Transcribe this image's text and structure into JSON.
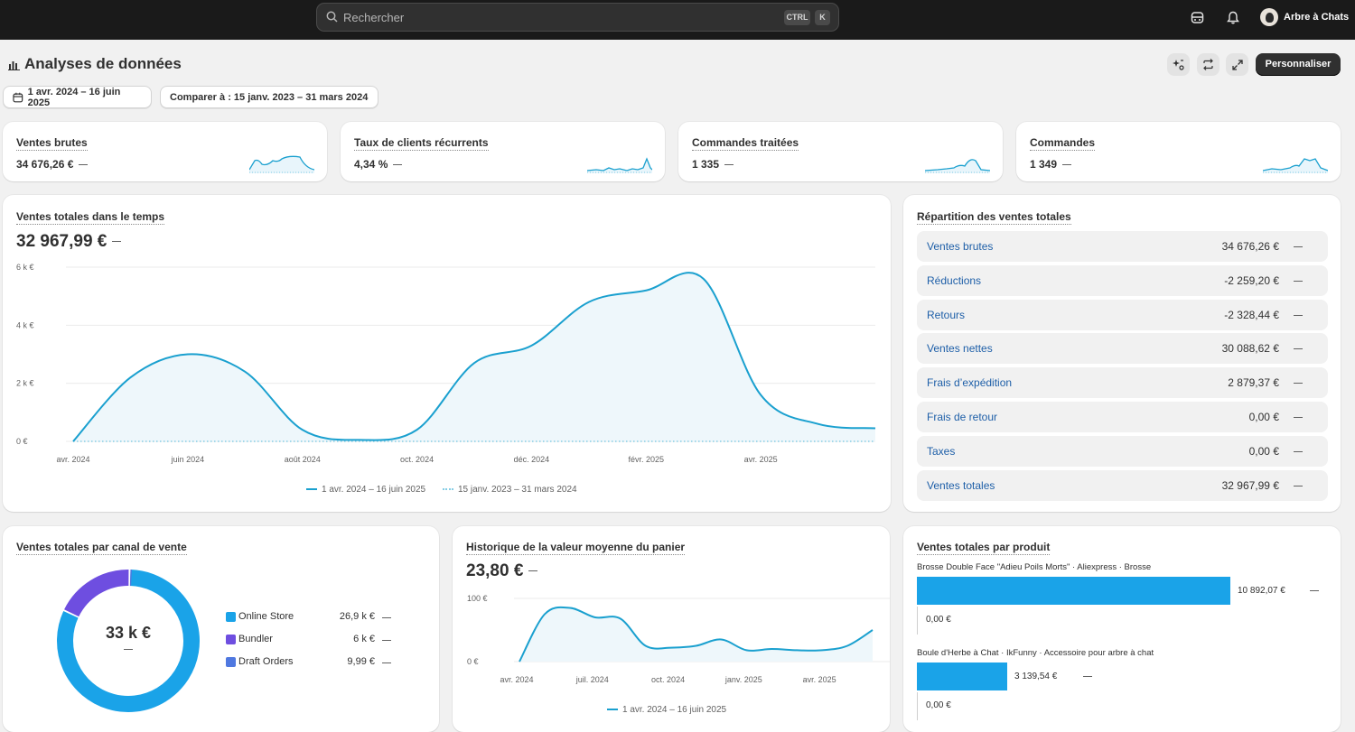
{
  "topbar": {
    "search_placeholder": "Rechercher",
    "kbd_ctrl": "CTRL",
    "kbd_k": "K",
    "store_name": "Arbre à Chats"
  },
  "header": {
    "title": "Analyses de données",
    "customize_label": "Personnaliser",
    "date_range": "1 avr. 2024 – 16 juin 2025",
    "compare_range": "Comparer à : 15 janv. 2023 – 31 mars 2024"
  },
  "kpis": [
    {
      "label": "Ventes brutes",
      "value": "34 676,26 €"
    },
    {
      "label": "Taux de clients récurrents",
      "value": "4,34 %"
    },
    {
      "label": "Commandes traitées",
      "value": "1 335"
    },
    {
      "label": "Commandes",
      "value": "1 349"
    }
  ],
  "sales_over_time": {
    "title": "Ventes totales dans le temps",
    "total": "32 967,99 €",
    "legend_current": "1 avr. 2024 – 16 juin 2025",
    "legend_compare": "15 janv. 2023 – 31 mars 2024"
  },
  "breakdown": {
    "title": "Répartition des ventes totales",
    "rows": [
      {
        "label": "Ventes brutes",
        "value": "34 676,26 €"
      },
      {
        "label": "Réductions",
        "value": "-2 259,20 €"
      },
      {
        "label": "Retours",
        "value": "-2 328,44 €"
      },
      {
        "label": "Ventes nettes",
        "value": "30 088,62 €"
      },
      {
        "label": "Frais d’expédition",
        "value": "2 879,37 €"
      },
      {
        "label": "Frais de retour",
        "value": "0,00 €"
      },
      {
        "label": "Taxes",
        "value": "0,00 €"
      },
      {
        "label": "Ventes totales",
        "value": "32 967,99 €"
      }
    ]
  },
  "channels": {
    "title": "Ventes totales par canal de vente",
    "center_value": "33 k €",
    "items": [
      {
        "name": "Online Store",
        "value": "26,9 k €",
        "color": "#1aa3e8"
      },
      {
        "name": "Bundler",
        "value": "6 k €",
        "color": "#6e4ee0"
      },
      {
        "name": "Draft Orders",
        "value": "9,99 €",
        "color": "#4f78e0"
      }
    ]
  },
  "aov": {
    "title": "Historique de la valeur moyenne du panier",
    "value": "23,80 €",
    "legend_current": "1 avr. 2024 – 16 juin 2025"
  },
  "products": {
    "title": "Ventes totales par produit",
    "items": [
      {
        "name": "Brosse Double Face \"Adieu Poils Morts\" · Aliexpress · Brosse",
        "value": "10 892,07 €",
        "compare": "0,00 €"
      },
      {
        "name": "Boule d'Herbe à Chat · IkFunny · Accessoire pour arbre à chat",
        "value": "3 139,54 €",
        "compare": "0,00 €"
      }
    ]
  },
  "chart_data": [
    {
      "type": "line",
      "title": "Ventes totales dans le temps",
      "x": [
        "avr. 2024",
        "mai 2024",
        "juin 2024",
        "juil. 2024",
        "août 2024",
        "sept. 2024",
        "oct. 2024",
        "nov. 2024",
        "déc. 2024",
        "janv. 2025",
        "févr. 2025",
        "mars 2025",
        "avr. 2025",
        "mai 2025",
        "juin 2025"
      ],
      "x_tick_labels": [
        "avr. 2024",
        "juin 2024",
        "août 2024",
        "oct. 2024",
        "déc. 2024",
        "févr. 2025",
        "avr. 2025"
      ],
      "y_tick_labels": [
        "0 €",
        "2 k €",
        "4 k €",
        "6 k €"
      ],
      "ylim": [
        0,
        6000
      ],
      "series": [
        {
          "name": "1 avr. 2024 – 16 juin 2025",
          "values": [
            0,
            2200,
            3000,
            2400,
            400,
            50,
            400,
            2700,
            3300,
            4800,
            5200,
            5600,
            1600,
            600,
            450
          ]
        },
        {
          "name": "15 janv. 2023 – 31 mars 2024",
          "values": [
            0,
            0,
            0,
            0,
            0,
            0,
            0,
            0,
            0,
            0,
            0,
            0,
            0,
            0,
            0
          ]
        }
      ],
      "grid": true
    },
    {
      "type": "pie",
      "title": "Ventes totales par canal de vente",
      "categories": [
        "Online Store",
        "Bundler",
        "Draft Orders"
      ],
      "values": [
        26900,
        6000,
        9.99
      ]
    },
    {
      "type": "line",
      "title": "Historique de la valeur moyenne du panier",
      "x": [
        "avr. 2024",
        "mai 2024",
        "juin 2024",
        "juil. 2024",
        "août 2024",
        "sept. 2024",
        "oct. 2024",
        "nov. 2024",
        "déc. 2024",
        "janv. 2025",
        "févr. 2025",
        "mars 2025",
        "avr. 2025",
        "mai 2025",
        "juin 2025"
      ],
      "x_tick_labels": [
        "avr. 2024",
        "juil. 2024",
        "oct. 2024",
        "janv. 2025",
        "avr. 2025"
      ],
      "y_tick_labels": [
        "0 €",
        "100 €"
      ],
      "ylim": [
        0,
        100
      ],
      "series": [
        {
          "name": "1 avr. 2024 – 16 juin 2025",
          "values": [
            0,
            75,
            85,
            70,
            68,
            25,
            22,
            25,
            35,
            18,
            20,
            18,
            18,
            25,
            50
          ]
        }
      ],
      "grid": true
    },
    {
      "type": "bar",
      "title": "Ventes totales par produit",
      "categories": [
        "Brosse Double Face \"Adieu Poils Morts\" · Aliexpress · Brosse",
        "Boule d'Herbe à Chat · IkFunny · Accessoire pour arbre à chat"
      ],
      "series": [
        {
          "name": "1 avr. 2024 – 16 juin 2025",
          "values": [
            10892.07,
            3139.54
          ]
        },
        {
          "name": "15 janv. 2023 – 31 mars 2024",
          "values": [
            0,
            0
          ]
        }
      ]
    }
  ]
}
